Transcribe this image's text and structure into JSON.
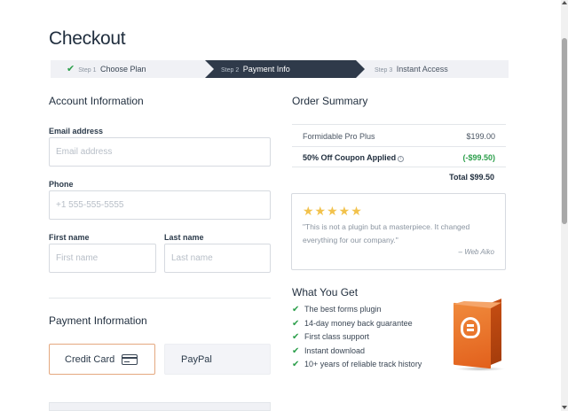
{
  "page": {
    "title": "Checkout"
  },
  "stepper": {
    "steps": [
      {
        "num": "Step 1",
        "label": "Choose Plan",
        "state": "done"
      },
      {
        "num": "Step 2",
        "label": "Payment Info",
        "state": "active"
      },
      {
        "num": "Step 3",
        "label": "Instant Access",
        "state": "pending"
      }
    ]
  },
  "account": {
    "heading": "Account Information",
    "email": {
      "label": "Email address",
      "placeholder": "Email address"
    },
    "phone": {
      "label": "Phone",
      "placeholder": "+1 555-555-5555"
    },
    "first_name": {
      "label": "First name",
      "placeholder": "First name"
    },
    "last_name": {
      "label": "Last name",
      "placeholder": "Last name"
    }
  },
  "payment": {
    "heading": "Payment Information",
    "options": [
      {
        "label": "Credit Card",
        "icon": "credit-card-icon",
        "selected": true
      },
      {
        "label": "PayPal",
        "selected": false
      }
    ]
  },
  "summary": {
    "heading": "Order Summary",
    "items": [
      {
        "label": "Formidable Pro Plus",
        "value": "$199.00"
      },
      {
        "label": "50% Off Coupon Applied",
        "value": "(-$99.50)"
      }
    ],
    "total": "Total $99.50"
  },
  "testimonial": {
    "stars": "★★★★★",
    "quote": "\"This is not a plugin but a masterpiece. It changed everything for our company.\"",
    "author": "– Web Aiko"
  },
  "benefits": {
    "heading": "What You Get",
    "items": [
      "The best forms plugin",
      "14-day money back guarantee",
      "First class support",
      "Instant download",
      "10+ years of reliable track history"
    ]
  },
  "colors": {
    "active_step": "#2f3a4a",
    "check_green": "#2c9f4b",
    "star": "#f2c24c",
    "selected_border": "#e4a87f",
    "product_orange": "#e2601c"
  }
}
